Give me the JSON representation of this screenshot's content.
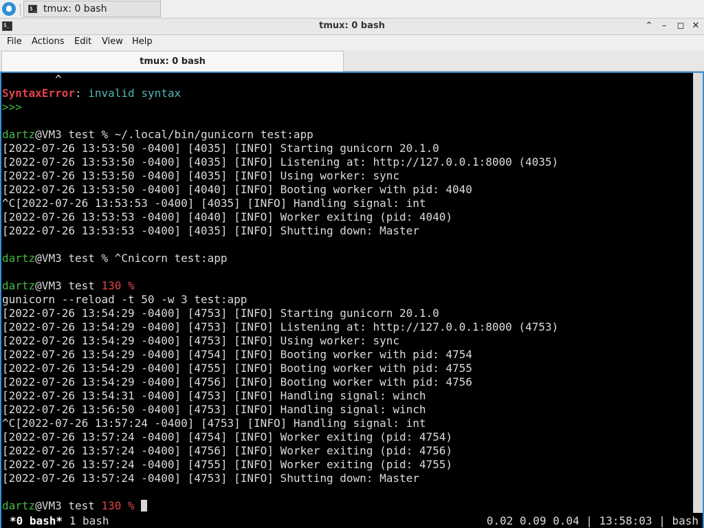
{
  "taskbar": {
    "task_label": "tmux: 0 bash"
  },
  "window": {
    "title": "tmux: 0 bash"
  },
  "menu": [
    "File",
    "Actions",
    "Edit",
    "View",
    "Help"
  ],
  "tab": {
    "label": "tmux: 0 bash"
  },
  "terminal": {
    "lines": [
      {
        "parts": [
          {
            "t": "        ^",
            "c": ""
          }
        ]
      },
      {
        "parts": [
          {
            "t": "SyntaxError",
            "c": "err"
          },
          {
            "t": ": ",
            "c": ""
          },
          {
            "t": "invalid syntax",
            "c": "cyan"
          }
        ]
      },
      {
        "parts": [
          {
            "t": ">>>",
            "c": "green"
          }
        ]
      },
      {
        "parts": [
          {
            "t": "",
            "c": ""
          }
        ]
      },
      {
        "parts": [
          {
            "t": "dartz",
            "c": "green"
          },
          {
            "t": "@VM3 test % ~/.local/bin/gunicorn test:app",
            "c": ""
          }
        ]
      },
      {
        "parts": [
          {
            "t": "[2022-07-26 13:53:50 -0400] [4035] [INFO] Starting gunicorn 20.1.0",
            "c": ""
          }
        ]
      },
      {
        "parts": [
          {
            "t": "[2022-07-26 13:53:50 -0400] [4035] [INFO] Listening at: http://127.0.0.1:8000 (4035)",
            "c": ""
          }
        ]
      },
      {
        "parts": [
          {
            "t": "[2022-07-26 13:53:50 -0400] [4035] [INFO] Using worker: sync",
            "c": ""
          }
        ]
      },
      {
        "parts": [
          {
            "t": "[2022-07-26 13:53:50 -0400] [4040] [INFO] Booting worker with pid: 4040",
            "c": ""
          }
        ]
      },
      {
        "parts": [
          {
            "t": "^C[2022-07-26 13:53:53 -0400] [4035] [INFO] Handling signal: int",
            "c": ""
          }
        ]
      },
      {
        "parts": [
          {
            "t": "[2022-07-26 13:53:53 -0400] [4040] [INFO] Worker exiting (pid: 4040)",
            "c": ""
          }
        ]
      },
      {
        "parts": [
          {
            "t": "[2022-07-26 13:53:53 -0400] [4035] [INFO] Shutting down: Master",
            "c": ""
          }
        ]
      },
      {
        "parts": [
          {
            "t": "",
            "c": ""
          }
        ]
      },
      {
        "parts": [
          {
            "t": "dartz",
            "c": "green"
          },
          {
            "t": "@VM3 test % ^Cnicorn test:app",
            "c": ""
          }
        ]
      },
      {
        "parts": [
          {
            "t": "",
            "c": ""
          }
        ]
      },
      {
        "parts": [
          {
            "t": "dartz",
            "c": "green"
          },
          {
            "t": "@VM3 test ",
            "c": ""
          },
          {
            "t": "130 %",
            "c": "red"
          }
        ]
      },
      {
        "parts": [
          {
            "t": "gunicorn --reload -t 50 -w 3 test:app",
            "c": ""
          }
        ]
      },
      {
        "parts": [
          {
            "t": "[2022-07-26 13:54:29 -0400] [4753] [INFO] Starting gunicorn 20.1.0",
            "c": ""
          }
        ]
      },
      {
        "parts": [
          {
            "t": "[2022-07-26 13:54:29 -0400] [4753] [INFO] Listening at: http://127.0.0.1:8000 (4753)",
            "c": ""
          }
        ]
      },
      {
        "parts": [
          {
            "t": "[2022-07-26 13:54:29 -0400] [4753] [INFO] Using worker: sync",
            "c": ""
          }
        ]
      },
      {
        "parts": [
          {
            "t": "[2022-07-26 13:54:29 -0400] [4754] [INFO] Booting worker with pid: 4754",
            "c": ""
          }
        ]
      },
      {
        "parts": [
          {
            "t": "[2022-07-26 13:54:29 -0400] [4755] [INFO] Booting worker with pid: 4755",
            "c": ""
          }
        ]
      },
      {
        "parts": [
          {
            "t": "[2022-07-26 13:54:29 -0400] [4756] [INFO] Booting worker with pid: 4756",
            "c": ""
          }
        ]
      },
      {
        "parts": [
          {
            "t": "[2022-07-26 13:54:31 -0400] [4753] [INFO] Handling signal: winch",
            "c": ""
          }
        ]
      },
      {
        "parts": [
          {
            "t": "[2022-07-26 13:56:50 -0400] [4753] [INFO] Handling signal: winch",
            "c": ""
          }
        ]
      },
      {
        "parts": [
          {
            "t": "^C[2022-07-26 13:57:24 -0400] [4753] [INFO] Handling signal: int",
            "c": ""
          }
        ]
      },
      {
        "parts": [
          {
            "t": "[2022-07-26 13:57:24 -0400] [4754] [INFO] Worker exiting (pid: 4754)",
            "c": ""
          }
        ]
      },
      {
        "parts": [
          {
            "t": "[2022-07-26 13:57:24 -0400] [4756] [INFO] Worker exiting (pid: 4756)",
            "c": ""
          }
        ]
      },
      {
        "parts": [
          {
            "t": "[2022-07-26 13:57:24 -0400] [4755] [INFO] Worker exiting (pid: 4755)",
            "c": ""
          }
        ]
      },
      {
        "parts": [
          {
            "t": "[2022-07-26 13:57:24 -0400] [4753] [INFO] Shutting down: Master",
            "c": ""
          }
        ]
      },
      {
        "parts": [
          {
            "t": "",
            "c": ""
          }
        ]
      },
      {
        "parts": [
          {
            "t": "dartz",
            "c": "green"
          },
          {
            "t": "@VM3 test ",
            "c": ""
          },
          {
            "t": "130 %",
            "c": "red"
          },
          {
            "t": " ",
            "c": ""
          }
        ],
        "cursor": true
      }
    ]
  },
  "status": {
    "active_window": "*0 bash*",
    "other_window": " 1 bash",
    "right": "0.02 0.09 0.04 | 13:58:03 | bash"
  },
  "colors": {
    "accent": "#3d8fd0",
    "prompt_user": "#46b946",
    "error": "#e2434f",
    "exit_code": "#e04646"
  }
}
